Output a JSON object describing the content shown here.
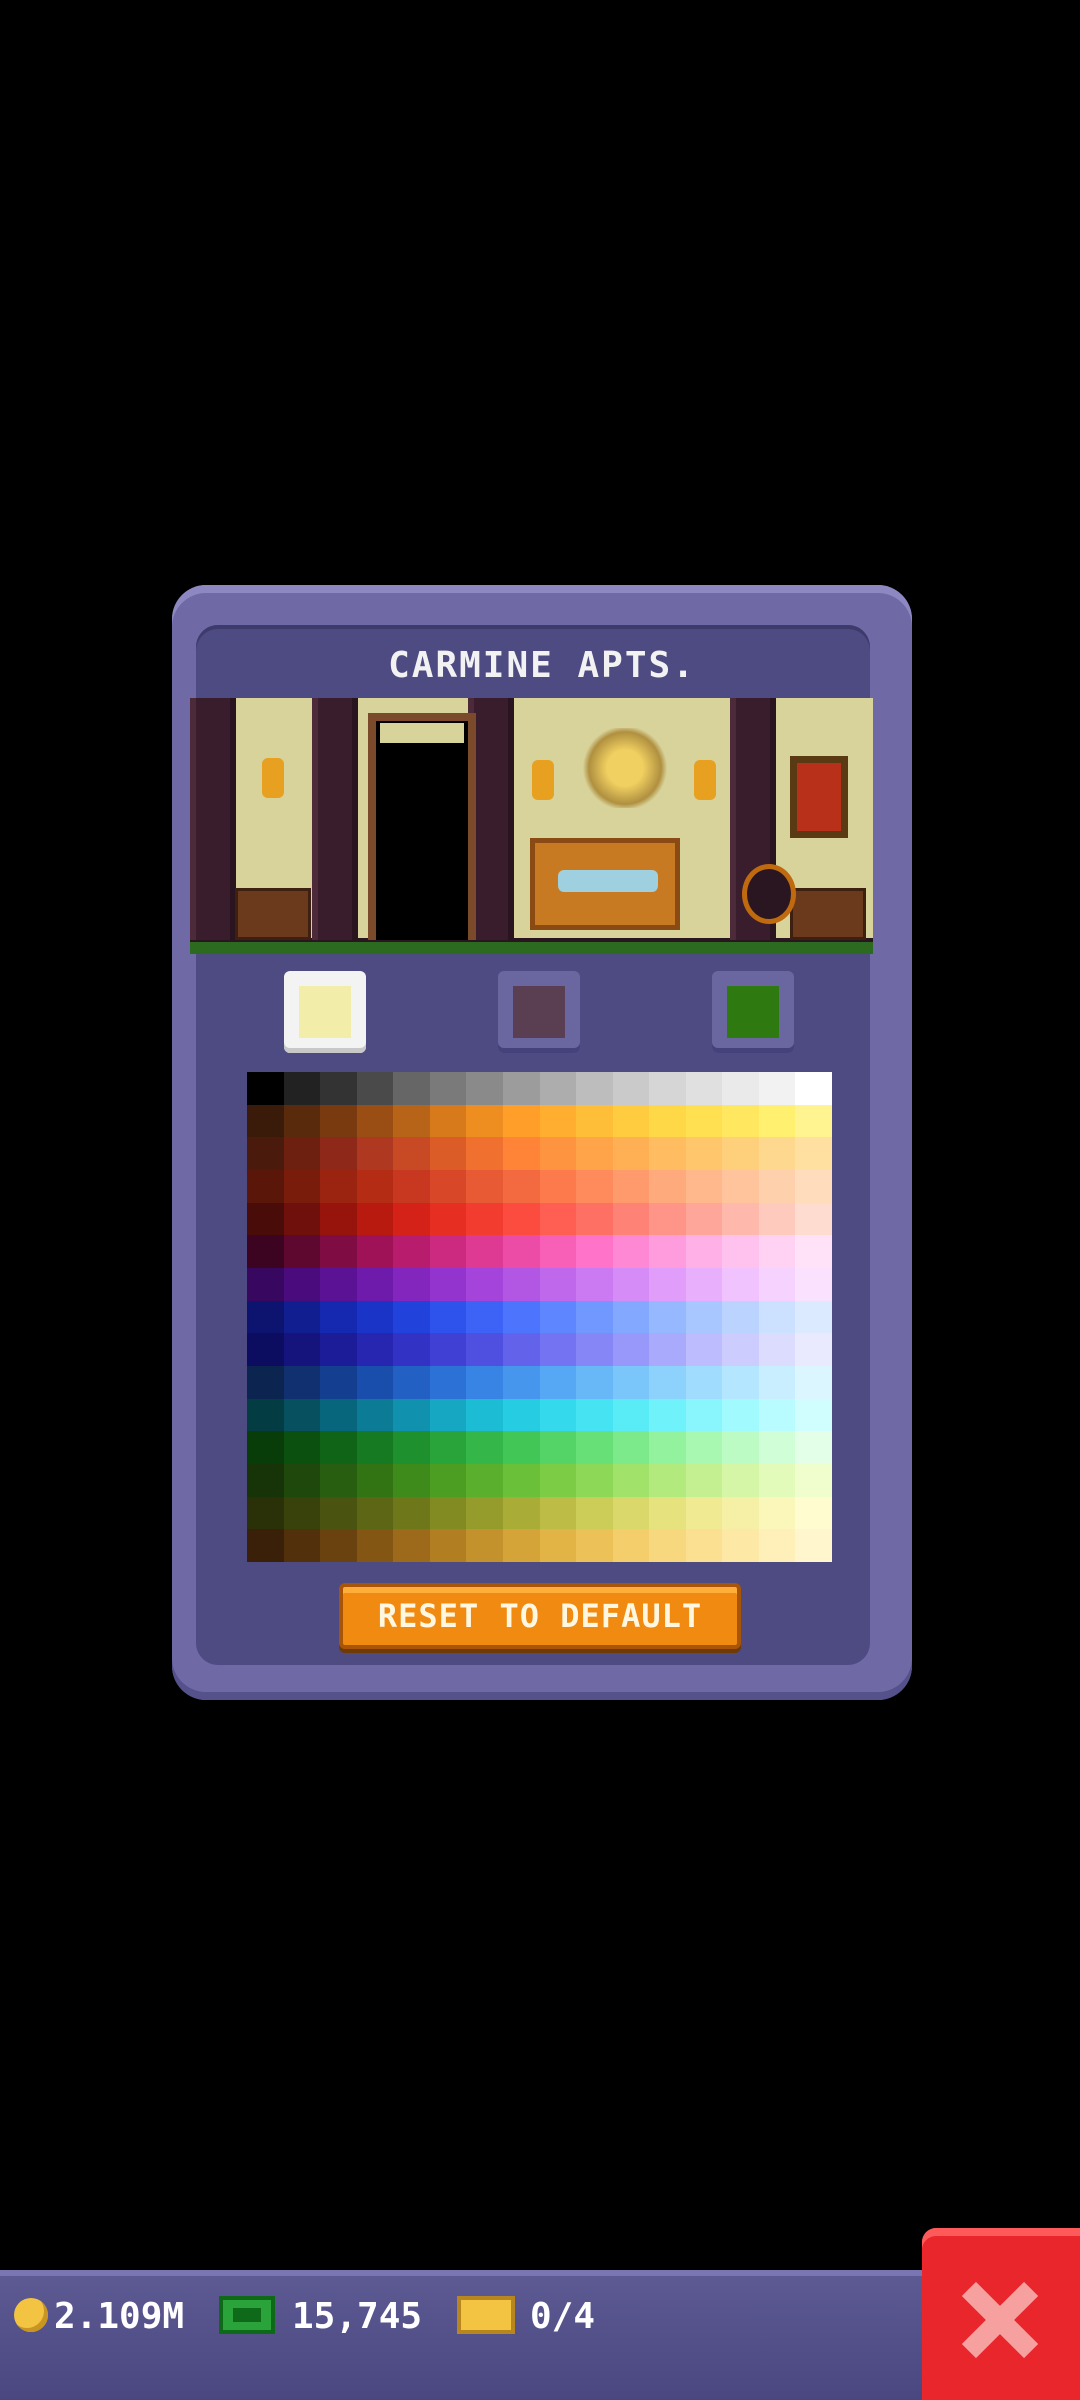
{
  "dialog": {
    "title": "CARMINE APTS.",
    "reset_label": "RESET TO DEFAULT"
  },
  "color_slots": [
    {
      "name": "wall-color",
      "color": "#f2eda8",
      "selected": true
    },
    {
      "name": "trim-color",
      "color": "#5a3f52",
      "selected": false
    },
    {
      "name": "floor-color",
      "color": "#2f7a10",
      "selected": false
    }
  ],
  "palette": [
    [
      "#000000",
      "#222222",
      "#333333",
      "#4a4a4a",
      "#666666",
      "#7a7a7a",
      "#8a8a8a",
      "#9c9c9c",
      "#adadad",
      "#bdbdbd",
      "#cacaca",
      "#d6d6d6",
      "#e0e0e0",
      "#eaeaea",
      "#f2f2f2",
      "#ffffff"
    ],
    [
      "#3a1a08",
      "#5a2a0c",
      "#7a3a10",
      "#9a4e14",
      "#b86418",
      "#d67a1c",
      "#ee8e20",
      "#ff9e28",
      "#ffae30",
      "#ffbe38",
      "#ffcc40",
      "#ffd848",
      "#ffe050",
      "#ffe860",
      "#fff070",
      "#fff490"
    ],
    [
      "#4a1a0c",
      "#6e2010",
      "#8e2818",
      "#ae3820",
      "#c84a24",
      "#dc5c28",
      "#f07030",
      "#ff8438",
      "#ff9440",
      "#ffa448",
      "#ffb054",
      "#ffbc60",
      "#ffc66c",
      "#ffd07c",
      "#ffd890",
      "#ffe0a0"
    ],
    [
      "#5a1608",
      "#7a1c0c",
      "#9a2410",
      "#b42c14",
      "#c83820",
      "#d84828",
      "#e85a34",
      "#f46a40",
      "#fc7a4c",
      "#ff8a5c",
      "#ff9a6c",
      "#ffaa7c",
      "#ffb88c",
      "#ffc49c",
      "#ffd0ac",
      "#ffdcbc"
    ],
    [
      "#4a0c08",
      "#70100c",
      "#96140c",
      "#b81a10",
      "#d42218",
      "#e62e22",
      "#f23c30",
      "#fc4c40",
      "#ff5e52",
      "#ff7064",
      "#ff8276",
      "#ff9488",
      "#ffa69a",
      "#ffb8ac",
      "#ffcabe",
      "#ffdcd0"
    ],
    [
      "#3c0420",
      "#5e0830",
      "#800c44",
      "#a01258",
      "#b81c6c",
      "#cc2a80",
      "#de3a94",
      "#ec4ca6",
      "#f860b8",
      "#ff74c8",
      "#ff88d4",
      "#ff9cde",
      "#ffb0e6",
      "#ffc2ee",
      "#ffd2f4",
      "#ffe2f8"
    ],
    [
      "#380860",
      "#4a0c7c",
      "#5c1294",
      "#6e1aaa",
      "#8226be",
      "#9434ce",
      "#a444da",
      "#b256e4",
      "#c068ec",
      "#cc7af2",
      "#d68cf6",
      "#e09efa",
      "#e8b0fc",
      "#f0c2fe",
      "#f6d2ff",
      "#fae2ff"
    ],
    [
      "#0c1470",
      "#101e90",
      "#1428b0",
      "#1a34c8",
      "#2242dc",
      "#2e52ec",
      "#3c62f6",
      "#4c74fc",
      "#5e86ff",
      "#7098ff",
      "#82a8ff",
      "#96b8ff",
      "#a8c6ff",
      "#bad4ff",
      "#cce0ff",
      "#dceaff"
    ],
    [
      "#0c0c60",
      "#14147c",
      "#1c1c98",
      "#2626b0",
      "#3232c4",
      "#4040d4",
      "#5050e0",
      "#6262ea",
      "#7474f2",
      "#8686f6",
      "#9898fa",
      "#aaaafc",
      "#bcbcfe",
      "#ccccff",
      "#dcdcff",
      "#eaeaff"
    ],
    [
      "#0c2450",
      "#103070",
      "#143e90",
      "#1a4eac",
      "#2260c4",
      "#2c72d6",
      "#3884e4",
      "#4696ee",
      "#56a8f4",
      "#68b8f8",
      "#7ac6fa",
      "#8cd2fc",
      "#a0dcfe",
      "#b4e6ff",
      "#c8eeff",
      "#dcf6ff"
    ],
    [
      "#043c44",
      "#065060",
      "#08667c",
      "#0c7c96",
      "#1092ae",
      "#16a8c2",
      "#1cbcd4",
      "#26cce2",
      "#34daec",
      "#46e4f2",
      "#5aecf6",
      "#70f2fa",
      "#88f6fc",
      "#a0fafe",
      "#b8fcff",
      "#d0feff"
    ],
    [
      "#083c08",
      "#0c5010",
      "#106418",
      "#167a22",
      "#1e902e",
      "#28a43a",
      "#34b648",
      "#42c656",
      "#54d466",
      "#68e078",
      "#7cea8a",
      "#92f29e",
      "#a8f8b2",
      "#bcfcc4",
      "#d0fed6",
      "#e4ffe8"
    ],
    [
      "#163408",
      "#1e480c",
      "#285e10",
      "#327414",
      "#3e8a1a",
      "#4c9e22",
      "#5ab02c",
      "#6ac038",
      "#7ccc46",
      "#8ed858",
      "#a0e26a",
      "#b2ea7e",
      "#c4f092",
      "#d4f6a6",
      "#e2faba",
      "#f0fece"
    ],
    [
      "#2a3008",
      "#3a420c",
      "#4a5410",
      "#5c6614",
      "#6e781a",
      "#828a22",
      "#969c2c",
      "#aaac38",
      "#bcbc46",
      "#cccc58",
      "#dad86a",
      "#e6e27e",
      "#f0ea92",
      "#f6f0a6",
      "#fbf6ba",
      "#fffcd0"
    ],
    [
      "#3a2008",
      "#52300c",
      "#6a4210",
      "#845614",
      "#9c6a1a",
      "#b27e22",
      "#c4922c",
      "#d4a438",
      "#e2b446",
      "#ecc258",
      "#f4ce6a",
      "#f8d87e",
      "#fce092",
      "#fee8a6",
      "#fff0ba",
      "#fff6ce"
    ]
  ],
  "status_bar": {
    "coins": "2.109M",
    "bux": "15,745",
    "tickets": "0/4"
  },
  "icons": {
    "coin": "coin-icon",
    "bux": "bux-icon",
    "ticket": "ticket-icon",
    "close": "close-icon"
  }
}
